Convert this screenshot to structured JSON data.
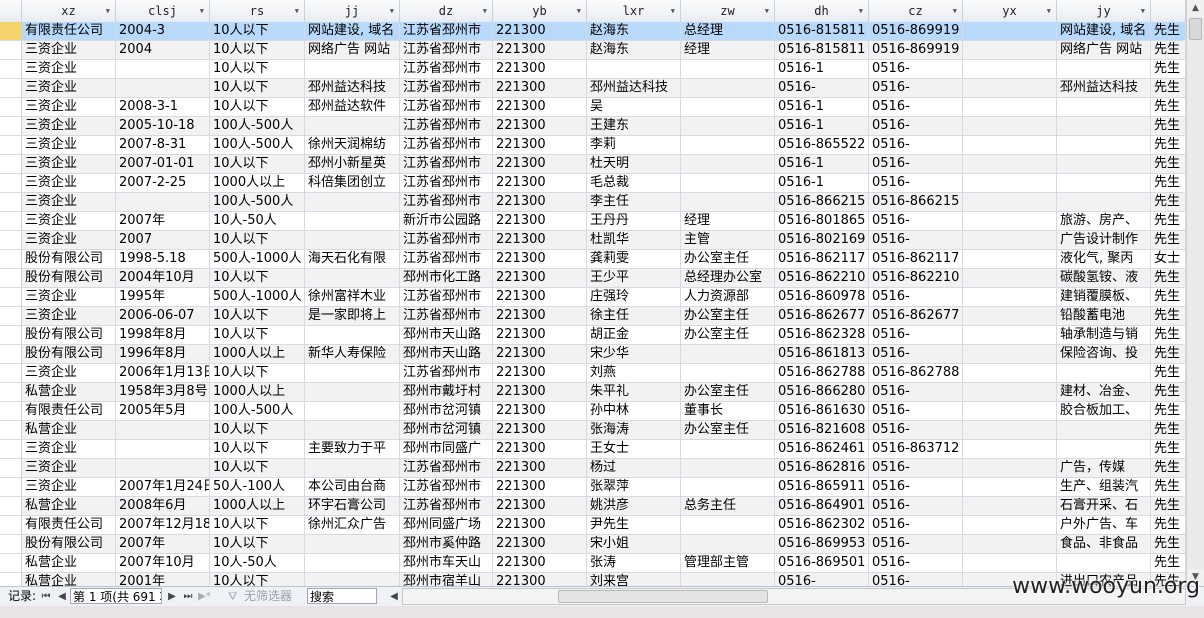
{
  "columns": [
    "xz",
    "clsj",
    "rs",
    "jj",
    "dz",
    "yb",
    "lxr",
    "zw",
    "dh",
    "cz",
    "yx",
    "jy",
    ""
  ],
  "rows": [
    [
      "有限责任公司",
      "2004-3",
      "10人以下",
      "网站建设, 域名",
      "江苏省邳州市",
      "221300",
      "赵海东",
      "总经理",
      "0516-815811",
      "0516-869919",
      "",
      "网站建设, 域名",
      "先生"
    ],
    [
      "三资企业",
      "2004",
      "10人以下",
      "网络广告 网站",
      "江苏省邳州市",
      "221300",
      "赵海东",
      "经理",
      "0516-815811",
      "0516-869919",
      "",
      "网络广告 网站",
      "先生"
    ],
    [
      "三资企业",
      "",
      "10人以下",
      "",
      "江苏省邳州市",
      "221300",
      "",
      "",
      "0516-1",
      "0516-",
      "",
      "",
      "先生"
    ],
    [
      "三资企业",
      "",
      "10人以下",
      "邳州益达科技",
      "江苏省邳州市",
      "221300",
      "邳州益达科技",
      "",
      "0516-",
      "0516-",
      "",
      "邳州益达科技",
      "先生"
    ],
    [
      "三资企业",
      "2008-3-1",
      "10人以下",
      "邳州益达软件",
      "江苏省邳州市",
      "221300",
      "吴",
      "",
      "0516-1",
      "0516-",
      "",
      "",
      "先生"
    ],
    [
      "三资企业",
      "2005-10-18",
      "100人-500人",
      "",
      "江苏省邳州市",
      "221300",
      "王建东",
      "",
      "0516-1",
      "0516-",
      "",
      "",
      "先生"
    ],
    [
      "三资企业",
      "2007-8-31",
      "100人-500人",
      "徐州天润棉纺",
      "江苏省邳州市",
      "221300",
      "李莉",
      "",
      "0516-865522",
      "0516-",
      "",
      "",
      "先生"
    ],
    [
      "三资企业",
      "2007-01-01",
      "10人以下",
      "邳州小新星英",
      "江苏省邳州市",
      "221300",
      "杜天明",
      "",
      "0516-1",
      "0516-",
      "",
      "",
      "先生"
    ],
    [
      "三资企业",
      "2007-2-25",
      "1000人以上",
      "科倍集团创立",
      "江苏省邳州市",
      "221300",
      "毛总裁",
      "",
      "0516-1",
      "0516-",
      "",
      "",
      "先生"
    ],
    [
      "三资企业",
      "",
      "100人-500人",
      "",
      "江苏省邳州市",
      "221300",
      "李主任",
      "",
      "0516-866215",
      "0516-866215",
      "",
      "",
      "先生"
    ],
    [
      "三资企业",
      "2007年",
      "10人-50人",
      "",
      "新沂市公园路",
      "221300",
      "王丹丹",
      "经理",
      "0516-801865",
      "0516-",
      "",
      "旅游、房产、",
      "先生"
    ],
    [
      "三资企业",
      "2007",
      "10人以下",
      "",
      "江苏省邳州市",
      "221300",
      "杜凯华",
      "主管",
      "0516-802169",
      "0516-",
      "",
      "广告设计制作",
      "先生"
    ],
    [
      "股份有限公司",
      "1998-5.18",
      "500人-1000人",
      "海天石化有限",
      "江苏省邳州市",
      "221300",
      "龚莉雯",
      "办公室主任",
      "0516-862117",
      "0516-862117",
      "",
      "液化气, 聚丙",
      "女士"
    ],
    [
      "股份有限公司",
      "2004年10月",
      "10人以下",
      "",
      "邳州市化工路",
      "221300",
      "王少平",
      "总经理办公室",
      "0516-862210",
      "0516-862210",
      "",
      "碳酸氢铵、液",
      "先生"
    ],
    [
      "三资企业",
      "1995年",
      "500人-1000人",
      "徐州富祥木业",
      "江苏省邳州市",
      "221300",
      "庄强玲",
      "人力资源部",
      "0516-860978",
      "0516-",
      "",
      "建销覆膜板、",
      "先生"
    ],
    [
      "三资企业",
      "2006-06-07",
      "10人以下",
      "是一家即将上",
      "江苏省邳州市",
      "221300",
      "徐主任",
      "办公室主任",
      "0516-862677",
      "0516-862677",
      "",
      "铅酸蓄电池",
      "先生"
    ],
    [
      "股份有限公司",
      "1998年8月",
      "10人以下",
      "",
      "邳州市天山路",
      "221300",
      "胡正金",
      "办公室主任",
      "0516-862328",
      "0516-",
      "",
      "轴承制造与销",
      "先生"
    ],
    [
      "股份有限公司",
      "1996年8月",
      "1000人以上",
      "新华人寿保险",
      "邳州市天山路",
      "221300",
      "宋少华",
      "",
      "0516-861813",
      "0516-",
      "",
      "保险咨询、投",
      "先生"
    ],
    [
      "三资企业",
      "2006年1月13日",
      "10人以下",
      "",
      "江苏省邳州市",
      "221300",
      "刘燕",
      "",
      "0516-862788",
      "0516-862788",
      "",
      "",
      "先生"
    ],
    [
      "私营企业",
      "1958年3月8号",
      "1000人以上",
      "",
      "邳州市戴圩村",
      "221300",
      "朱平礼",
      "办公室主任",
      "0516-866280",
      "0516-",
      "",
      "建材、冶金、",
      "先生"
    ],
    [
      "有限责任公司",
      "2005年5月",
      "100人-500人",
      "",
      "邳州市岔河镇",
      "221300",
      "孙中林",
      "董事长",
      "0516-861630",
      "0516-",
      "",
      "胶合板加工、",
      "先生"
    ],
    [
      "私营企业",
      "",
      "10人以下",
      "",
      "邳州市岔河镇",
      "221300",
      "张海涛",
      "办公室主任",
      "0516-821608",
      "0516-",
      "",
      "",
      "先生"
    ],
    [
      "三资企业",
      "",
      "10人以下",
      "主要致力于平",
      "邳州市同盛广",
      "221300",
      "王女士",
      "",
      "0516-862461",
      "0516-863712",
      "",
      "",
      "先生"
    ],
    [
      "三资企业",
      "",
      "10人以下",
      "",
      "江苏省邳州市",
      "221300",
      "杨过",
      "",
      "0516-862816",
      "0516-",
      "",
      "广告，传媒",
      "先生"
    ],
    [
      "三资企业",
      "2007年1月24日",
      "50人-100人",
      "本公司由台商",
      "江苏省邳州市",
      "221300",
      "张翠萍",
      "",
      "0516-865911",
      "0516-",
      "",
      "生产、组装汽",
      "先生"
    ],
    [
      "私营企业",
      "2008年6月",
      "1000人以上",
      "环宇石膏公司",
      "江苏省邳州市",
      "221300",
      "姚洪彦",
      "总务主任",
      "0516-864901",
      "0516-",
      "",
      "石膏开采、石",
      "先生"
    ],
    [
      "有限责任公司",
      "2007年12月18日",
      "10人以下",
      "徐州汇众广告",
      "邳州同盛广场",
      "221300",
      "尹先生",
      "",
      "0516-862302",
      "0516-",
      "",
      "户外广告、车",
      "先生"
    ],
    [
      "股份有限公司",
      "2007年",
      "10人以下",
      "",
      "邳州市奚仲路",
      "221300",
      "宋小姐",
      "",
      "0516-869953",
      "0516-",
      "",
      "食品、非食品",
      "先生"
    ],
    [
      "私营企业",
      "2007年10月",
      "10人-50人",
      "",
      "邳州市车天山",
      "221300",
      "张涛",
      "管理部主管",
      "0516-869501",
      "0516-",
      "",
      "",
      "先生"
    ],
    [
      "私营企业",
      "2001年",
      "10人以下",
      "",
      "邳州市宿羊山",
      "221300",
      "刘来宫",
      "",
      "0516-",
      "0516-",
      "",
      "进出口农产品",
      "先生"
    ]
  ],
  "status": {
    "record_label": "记录:",
    "record_value": "第 1 项(共 691 项)",
    "filter_label": "无筛选器",
    "search_label": "搜索"
  },
  "watermark": "www.wooyun.org"
}
